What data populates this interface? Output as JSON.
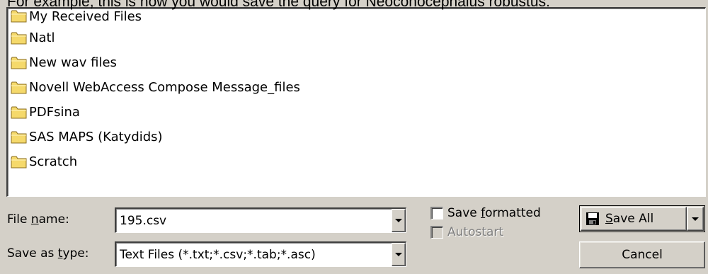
{
  "caption": "For example, this is how you would save the query for Neoconocephalus robustus:",
  "folders": [
    {
      "name": "My Received Files",
      "icon": "folder-icon"
    },
    {
      "name": "Natl",
      "icon": "folder-icon"
    },
    {
      "name": "New wav files",
      "icon": "folder-icon"
    },
    {
      "name": "Novell WebAccess Compose Message_files",
      "icon": "folder-icon"
    },
    {
      "name": "PDFsina",
      "icon": "folder-icon"
    },
    {
      "name": "SAS MAPS (Katydids)",
      "icon": "folder-icon"
    },
    {
      "name": "Scratch",
      "icon": "folder-icon"
    }
  ],
  "file_name": {
    "label": "File name:",
    "value": "195.csv"
  },
  "save_type": {
    "label": "Save as type:",
    "value": "Text Files (*.txt;*.csv;*.tab;*.asc)"
  },
  "options": {
    "save_formatted": {
      "label": "Save formatted",
      "checked": false
    },
    "autostart": {
      "label": "Autostart",
      "checked": false,
      "disabled": true
    }
  },
  "buttons": {
    "save_all": "Save All",
    "cancel": "Cancel"
  },
  "colors": {
    "dialog_bg": "#d4d0c8",
    "folder_yellow": "#f5d96b",
    "disk_icon": "#000000"
  }
}
